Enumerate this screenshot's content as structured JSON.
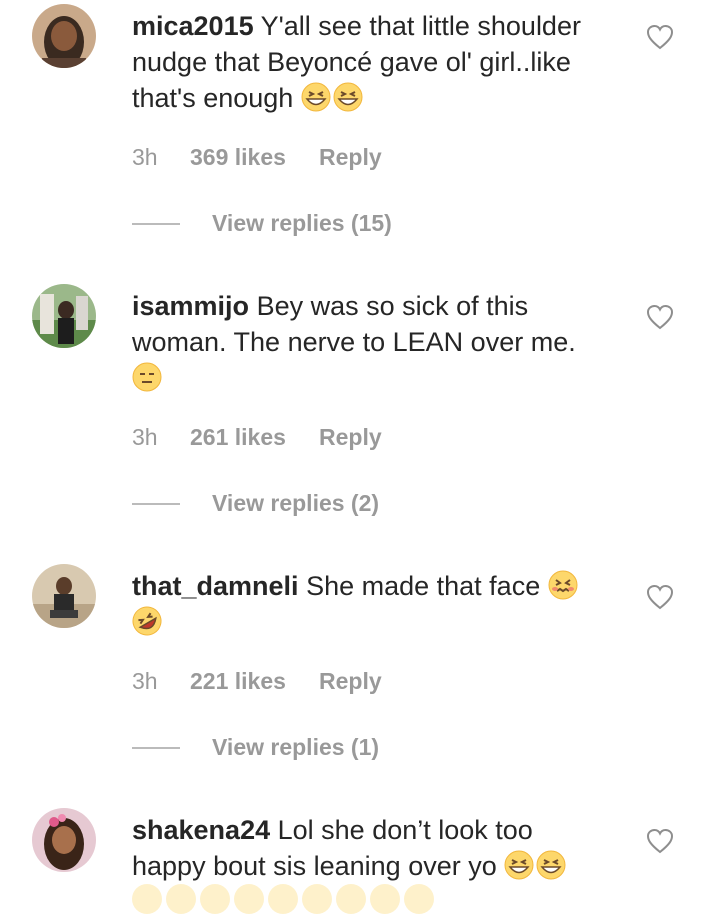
{
  "comments": [
    {
      "username": "mica2015",
      "text": "Y'all see that little shoulder nudge that Beyoncé gave ol' girl..like that's enough",
      "emoji": [
        "grinning-squinting-face",
        "grinning-squinting-face"
      ],
      "time": "3h",
      "likes": "369 likes",
      "reply_label": "Reply",
      "view_replies": "View replies (15)"
    },
    {
      "username": "isammijo",
      "text": "Bey was so sick of this woman. The nerve to LEAN over me.",
      "emoji": [
        "expressionless-face"
      ],
      "time": "3h",
      "likes": "261 likes",
      "reply_label": "Reply",
      "view_replies": "View replies (2)"
    },
    {
      "username": "that_damneli",
      "text": "She made that face",
      "emoji": [
        "confounded-face",
        "rolling-on-floor-laughing"
      ],
      "time": "3h",
      "likes": "221 likes",
      "reply_label": "Reply",
      "view_replies": "View replies (1)"
    },
    {
      "username": "shakena24",
      "text": "Lol she don’t look too happy bout sis leaning over yo",
      "emoji": [
        "grinning-squinting-face",
        "grinning-squinting-face"
      ],
      "time": "",
      "likes": "",
      "reply_label": "",
      "view_replies": ""
    }
  ],
  "icons": {
    "like": "heart-outline-icon"
  },
  "colors": {
    "text": "#262626",
    "muted": "#999999",
    "emoji_yellow": "#FDD76B"
  }
}
